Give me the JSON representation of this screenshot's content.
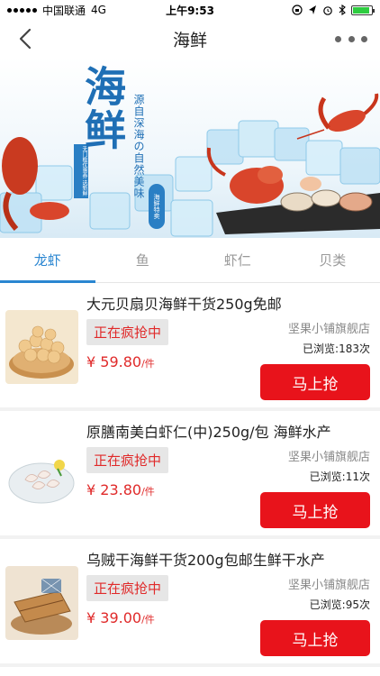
{
  "status_bar": {
    "carrier": "中国联通",
    "network": "4G",
    "time": "上午9:53",
    "battery_level": 0.9
  },
  "nav": {
    "title": "海鲜",
    "back_icon": "chevron-left-icon",
    "more_icon": "more-dots-icon"
  },
  "banner": {
    "title": "海鲜",
    "subtitle": "源自深海の自然美味",
    "tag_left": "无门槛优惠券 选新鲜",
    "seal": "海鲜特卖"
  },
  "tabs": [
    {
      "label": "龙虾",
      "active": true
    },
    {
      "label": "鱼",
      "active": false
    },
    {
      "label": "虾仁",
      "active": false
    },
    {
      "label": "贝类",
      "active": false
    }
  ],
  "products": [
    {
      "title": "大元贝扇贝海鲜干货250g免邮",
      "badge": "正在疯抢中",
      "shop": "坚果小铺旗舰店",
      "views": "已浏览:183次",
      "price": "¥ 59.80",
      "unit": "/件",
      "button": "马上抢"
    },
    {
      "title": "原膳南美白虾仁(中)250g/包 海鲜水产",
      "badge": "正在疯抢中",
      "shop": "坚果小铺旗舰店",
      "views": "已浏览:11次",
      "price": "¥ 23.80",
      "unit": "/件",
      "button": "马上抢"
    },
    {
      "title": "乌贼干海鲜干货200g包邮生鲜干水产",
      "badge": "正在疯抢中",
      "shop": "坚果小铺旗舰店",
      "views": "已浏览:95次",
      "price": "¥ 39.00",
      "unit": "/件",
      "button": "马上抢"
    }
  ],
  "colors": {
    "accent": "#2a86d1",
    "price": "#e02a2a",
    "button": "#e8131b"
  }
}
